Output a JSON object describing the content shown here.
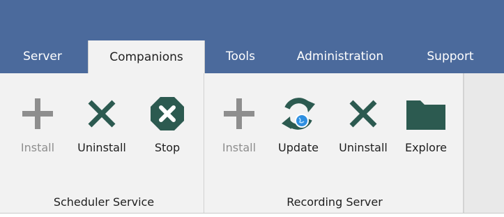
{
  "tabs": [
    "Server",
    "Companions",
    "Tools",
    "Administration",
    "Support"
  ],
  "active_tab": "Companions",
  "groups": {
    "scheduler": {
      "label": "Scheduler Service",
      "buttons": {
        "install": {
          "label": "Install",
          "icon": "plus-icon",
          "enabled": false
        },
        "uninstall": {
          "label": "Uninstall",
          "icon": "x-icon",
          "enabled": true
        },
        "stop": {
          "label": "Stop",
          "icon": "stop-octagon-icon",
          "enabled": true
        }
      }
    },
    "recording": {
      "label": "Recording Server",
      "buttons": {
        "install": {
          "label": "Install",
          "icon": "plus-icon",
          "enabled": false
        },
        "update": {
          "label": "Update",
          "icon": "update-globe-icon",
          "enabled": true
        },
        "uninstall": {
          "label": "Uninstall",
          "icon": "x-icon",
          "enabled": true
        },
        "explore": {
          "label": "Explore",
          "icon": "folder-icon",
          "enabled": true
        }
      }
    }
  },
  "colors": {
    "header": "#4b6a9c",
    "ribbon": "#f2f2f2",
    "icon_active": "#2c5a50",
    "icon_disabled": "#8e8e8e",
    "globe": "#2f8fe0"
  }
}
